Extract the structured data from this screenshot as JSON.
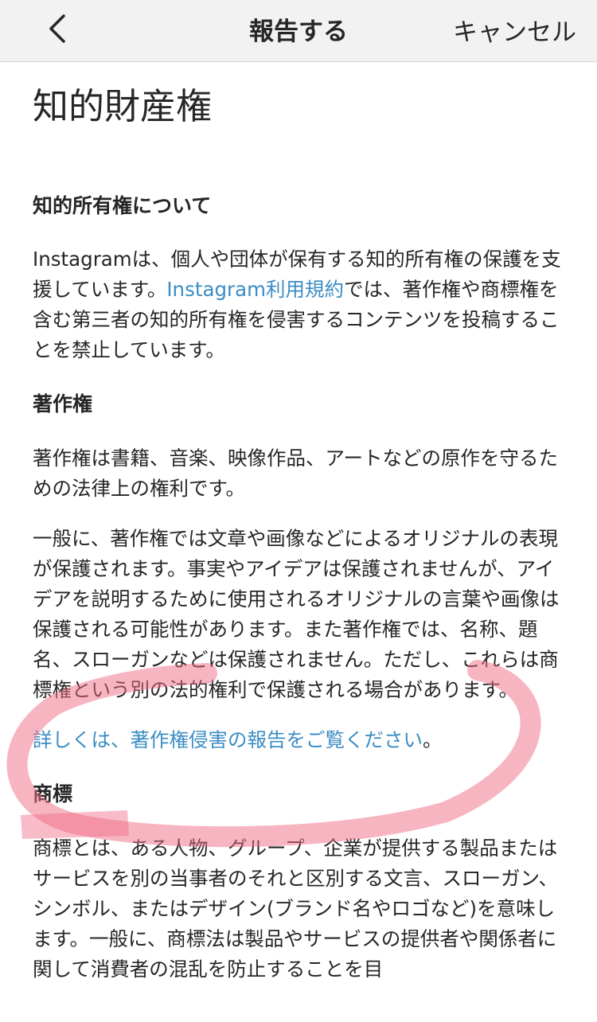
{
  "navbar": {
    "title": "報告する",
    "cancel_label": "キャンセル"
  },
  "page": {
    "title": "知的財産権",
    "intro_heading": "知的所有権について",
    "intro": {
      "part1": "Instagramは、個人や団体が保有する知的所有権の保護を支援しています。",
      "terms_link": "Instagram利用規約",
      "part2": "では、著作権や商標権を含む第三者の知的所有権を侵害するコンテンツを投稿することを禁止しています。"
    },
    "copyright_heading": "著作権",
    "copyright_p1": "著作権は書籍、音楽、映像作品、アートなどの原作を守るための法律上の権利です。",
    "copyright_p2": "一般に、著作権では文章や画像などによるオリジナルの表現が保護されます。事実やアイデアは保護されませんが、アイデアを説明するために使用されるオリジナルの言葉や画像は保護される可能性があります。また著作権では、名称、題名、スローガンなどは保護されません。ただし、これらは商標権という別の法的権利で保護される場合があります。",
    "copyright_link": "詳しくは、著作権侵害の報告をご覧ください",
    "copyright_link_suffix": "。",
    "trademark_heading": "商標",
    "trademark_p1": "商標とは、ある人物、グループ、企業が提供する製品またはサービスを別の当事者のそれと区別する文言、スローガン、シンボル、またはデザイン(ブランド名やロゴなど)を意味します。一般に、商標法は製品やサービスの提供者や関係者に関して消費者の混乱を防止することを目"
  },
  "colors": {
    "link": "#3b8dc4",
    "annotation": "#f06b86"
  },
  "icons": {
    "back": "chevron-left-icon"
  }
}
